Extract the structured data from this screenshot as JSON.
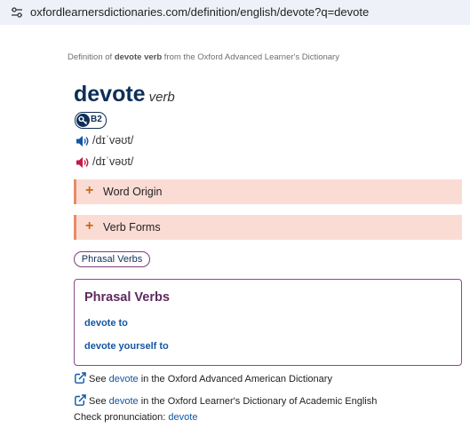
{
  "browser": {
    "url": "oxfordlearnersdictionaries.com/definition/english/devote?q=devote",
    "site_info_icon": "tune-icon"
  },
  "breadcrumb": {
    "prefix": "Definition of ",
    "term": "devote verb",
    "suffix": " from the Oxford Advanced Learner's Dictionary"
  },
  "entry": {
    "headword": "devote",
    "pos": "verb",
    "level": "B2",
    "pron_uk": "/dɪˈvəʊt/",
    "pron_us": "/dɪˈvəʊt/"
  },
  "sections": {
    "word_origin": "Word Origin",
    "verb_forms": "Verb Forms",
    "plus": "+"
  },
  "phrasal_pill": "Phrasal Verbs",
  "phrasal_box": {
    "title": "Phrasal Verbs",
    "items": [
      "devote to",
      "devote yourself to"
    ]
  },
  "see_links": [
    {
      "pre": "See ",
      "word": "devote",
      "post": " in the Oxford Advanced American Dictionary"
    },
    {
      "pre": "See ",
      "word": "devote",
      "post": " in the Oxford Learner's Dictionary of Academic English"
    }
  ],
  "check": {
    "label": "Check pronunciation: ",
    "word": "devote"
  },
  "colors": {
    "headword": "#0d2e57",
    "link": "#1456a2",
    "uk_speaker": "#1456a2",
    "us_speaker": "#c8174a",
    "bar_bg": "#fbdcd5",
    "box_border": "#8b4b8b"
  }
}
